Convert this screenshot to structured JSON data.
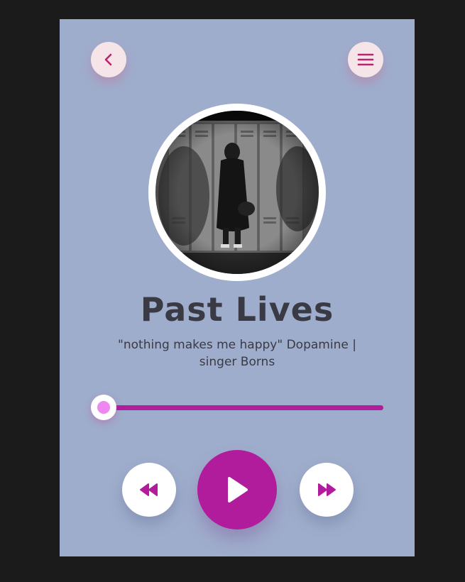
{
  "player": {
    "title": "Past Lives",
    "subtitle": "\"nothing makes me happy\" Dopamine | singer Borns",
    "progress": 0.0
  },
  "icons": {
    "back": "chevron-left-icon",
    "menu": "hamburger-menu-icon",
    "rewind": "rewind-icon",
    "play": "play-icon",
    "forward": "fast-forward-icon"
  },
  "colors": {
    "background": "#1b1b1b",
    "card": "#9fadcc",
    "accent": "#b01c9c",
    "thumb_dot": "#ee88f0",
    "soft_button": "#f5e4e8",
    "text": "#3a3a44"
  }
}
